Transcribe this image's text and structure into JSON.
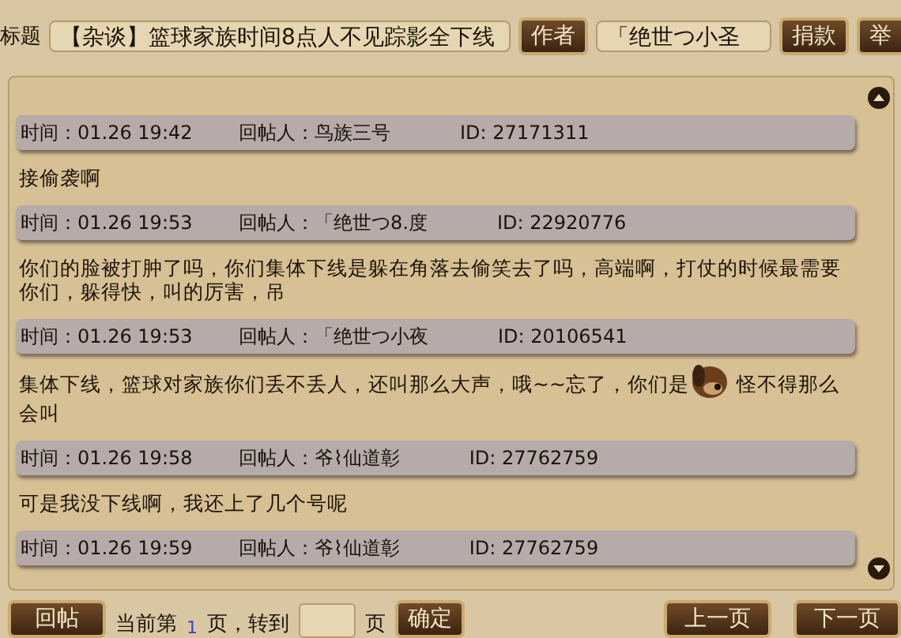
{
  "title_row": {
    "title_label": "标题",
    "title_value": "【杂谈】篮球家族时间8点人不见踪影全下线",
    "author_button": "作者",
    "author_value": "「绝世つ小圣",
    "donate_button": "捐款",
    "report_button": "举"
  },
  "posts": [
    {
      "time": "时间：01.26 19:42",
      "poster": "回帖人：鸟族三号",
      "id": "ID: 27171311",
      "body": [
        {
          "kind": "text",
          "text": "接偷袭啊"
        }
      ]
    },
    {
      "time": "时间：01.26 19:53",
      "poster": "回帖人：「绝世つ8.度",
      "id": "ID: 22920776",
      "body": [
        {
          "kind": "text",
          "text": "你们的脸被打肿了吗，你们集体下线是躲在角落去偷笑去了吗，高端啊，打仗的时候最需要你们，躲得快，叫的厉害，吊"
        }
      ]
    },
    {
      "time": "时间：01.26 19:53",
      "poster": "回帖人：「绝世つ小夜",
      "id": "ID: 20106541",
      "body": [
        {
          "kind": "text",
          "text": "集体下线，篮球对家族你们丢不丢人，还叫那么大声，哦~~忘了，你们是"
        },
        {
          "kind": "emoticon"
        },
        {
          "kind": "text",
          "text": "怪不得那么会叫"
        }
      ]
    },
    {
      "time": "时间：01.26 19:58",
      "poster": "回帖人：爷⌇仙道彰",
      "id": "ID: 27762759",
      "body": [
        {
          "kind": "text",
          "text": "可是我没下线啊，我还上了几个号呢"
        }
      ]
    },
    {
      "time": "时间：01.26 19:59",
      "poster": "回帖人：爷⌇仙道彰",
      "id": "ID: 27762759"
    }
  ],
  "footer": {
    "reply_button": "回帖",
    "page_prefix": "当前第",
    "current_page": "1",
    "page_mid": "页，转到",
    "page_suffix": "页",
    "confirm_button": "确定",
    "prev_button": "上一页",
    "next_button": "下一页"
  }
}
